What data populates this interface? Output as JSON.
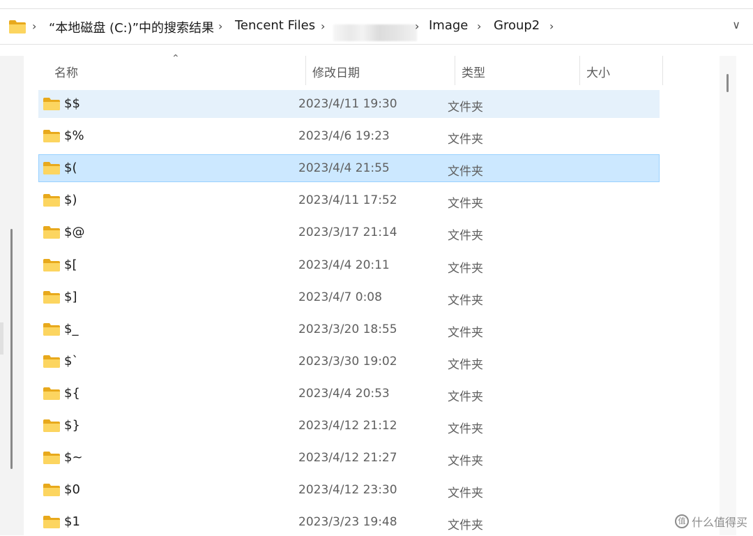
{
  "address_bar": {
    "crumbs": [
      "“本地磁盘 (C:)”中的搜索结果",
      "Tencent Files",
      "Image",
      "Group2"
    ],
    "separator": ">"
  },
  "columns": {
    "name": "名称",
    "modified": "修改日期",
    "type": "类型",
    "size": "大小"
  },
  "rows": [
    {
      "name": "$$",
      "date": "2023/4/11 19:30",
      "type": "文件夹"
    },
    {
      "name": "$%",
      "date": "2023/4/6 19:23",
      "type": "文件夹"
    },
    {
      "name": "$(",
      "date": "2023/4/4 21:55",
      "type": "文件夹"
    },
    {
      "name": "$)",
      "date": "2023/4/11 17:52",
      "type": "文件夹"
    },
    {
      "name": "$@",
      "date": "2023/3/17 21:14",
      "type": "文件夹"
    },
    {
      "name": "$[",
      "date": "2023/4/4 20:11",
      "type": "文件夹"
    },
    {
      "name": "$]",
      "date": "2023/4/7 0:08",
      "type": "文件夹"
    },
    {
      "name": "$_",
      "date": "2023/3/20 18:55",
      "type": "文件夹"
    },
    {
      "name": "$`",
      "date": "2023/3/30 19:02",
      "type": "文件夹"
    },
    {
      "name": "${",
      "date": "2023/4/4 20:53",
      "type": "文件夹"
    },
    {
      "name": "$}",
      "date": "2023/4/12 21:12",
      "type": "文件夹"
    },
    {
      "name": "$~",
      "date": "2023/4/12 21:27",
      "type": "文件夹"
    },
    {
      "name": "$0",
      "date": "2023/4/12 23:30",
      "type": "文件夹"
    },
    {
      "name": "$1",
      "date": "2023/3/23 19:48",
      "type": "文件夹"
    }
  ],
  "watermark": {
    "logo": "值",
    "text": "什么值得买"
  },
  "colors": {
    "hover_row": "#e5f1fb",
    "selected_row": "#cce8ff",
    "selected_border": "#99d1ff",
    "folder_yellow": "#f8c93f"
  }
}
